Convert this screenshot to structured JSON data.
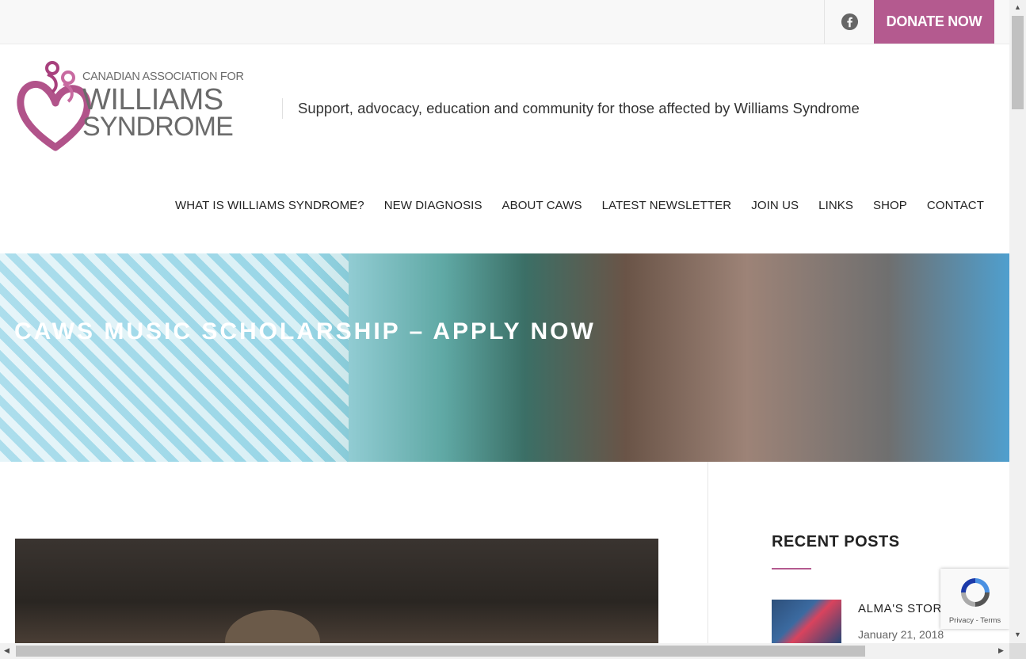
{
  "topbar": {
    "donate_label": "DONATE NOW",
    "facebook_icon": "facebook-icon",
    "accent_color": "#b45a8f"
  },
  "header": {
    "logo_line1": "CANADIAN ASSOCIATION FOR",
    "logo_line2": "WILLIAMS",
    "logo_line3": "SYNDROME",
    "tagline": "Support, advocacy, education and community for those affected by Williams Syndrome"
  },
  "nav": {
    "items": [
      {
        "label": "WHAT IS WILLIAMS SYNDROME?"
      },
      {
        "label": "NEW DIAGNOSIS"
      },
      {
        "label": "ABOUT CAWS"
      },
      {
        "label": "LATEST NEWSLETTER"
      },
      {
        "label": "JOIN US"
      },
      {
        "label": "LINKS"
      },
      {
        "label": "SHOP"
      },
      {
        "label": "CONTACT"
      }
    ]
  },
  "hero": {
    "title": "CAWS MUSIC SCHOLARSHIP – APPLY NOW"
  },
  "sidebar": {
    "recent_posts_title": "RECENT POSTS",
    "posts": [
      {
        "title": "ALMA'S STORY",
        "date": "January 21, 2018"
      }
    ]
  },
  "recaptcha": {
    "privacy": "Privacy",
    "separator": "-",
    "terms": "Terms"
  }
}
